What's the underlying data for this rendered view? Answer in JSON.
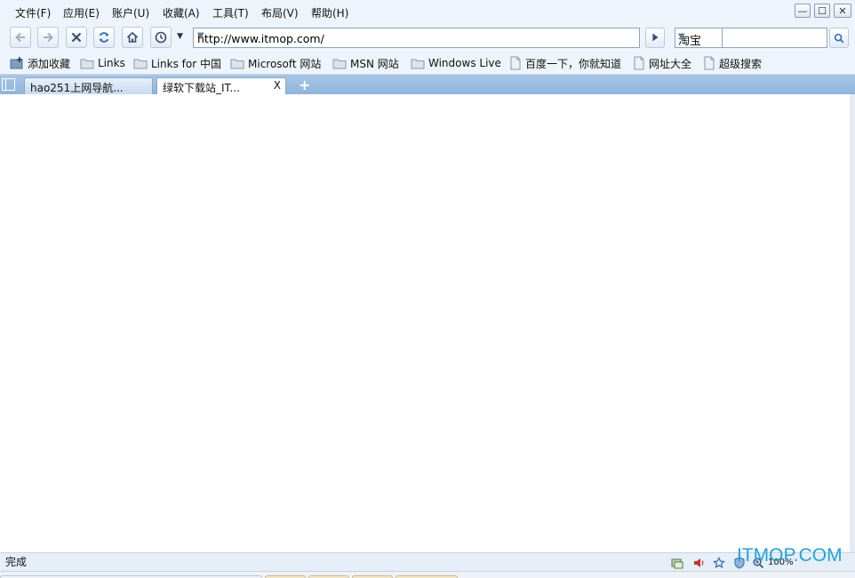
{
  "menu": {
    "items": [
      "文件(F)",
      "应用(E)",
      "账户(U)",
      "收藏(A)",
      "工具(T)",
      "布局(V)",
      "帮助(H)"
    ]
  },
  "toolbar": {
    "address_url": "http://www.itmop.com/",
    "search_engine": "淘宝",
    "search_value": ""
  },
  "bookmarks": {
    "items": [
      {
        "label": "添加收藏",
        "icon": "add-bookmark-icon"
      },
      {
        "label": "Links",
        "icon": "folder-icon"
      },
      {
        "label": "Links for 中国",
        "icon": "folder-icon"
      },
      {
        "label": "Microsoft 网站",
        "icon": "folder-icon"
      },
      {
        "label": "MSN 网站",
        "icon": "folder-icon"
      },
      {
        "label": "Windows Live",
        "icon": "folder-icon"
      },
      {
        "label": "百度一下，你就知道",
        "icon": "page-icon"
      },
      {
        "label": "网址大全",
        "icon": "page-icon"
      },
      {
        "label": "超级搜索",
        "icon": "page-icon"
      }
    ]
  },
  "tabs": [
    {
      "label": "hao251上网导航...",
      "active": false
    },
    {
      "label": "绿软下载站_IT...",
      "active": true,
      "close": "X"
    }
  ],
  "status": {
    "text": "完成",
    "zoom": "100%"
  },
  "watermark": "ITMOP.COM",
  "colors": {
    "tabbar": "#8fb4dc",
    "chrome": "#eef4fb",
    "watermark": "#23a3d8"
  }
}
